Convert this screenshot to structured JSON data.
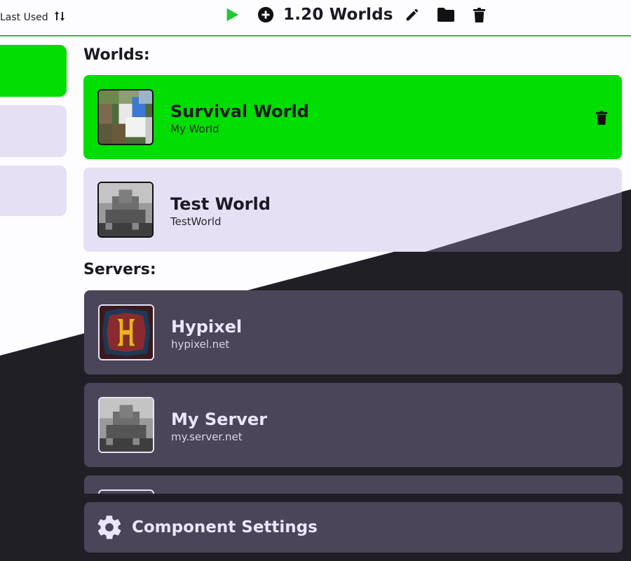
{
  "toolbar": {
    "sort_label": "Last Used",
    "title": "1.20 Worlds",
    "icons": [
      "play-icon",
      "add-icon",
      "edit-icon",
      "folder-icon",
      "trash-icon"
    ],
    "accent": "#22c832"
  },
  "sections": {
    "worlds": "Worlds:",
    "servers": "Servers:"
  },
  "worlds": [
    {
      "name": "Survival World",
      "sub": "My World",
      "selected": true
    },
    {
      "name": "Test World",
      "sub": "TestWorld",
      "selected": false
    }
  ],
  "servers": [
    {
      "name": "Hypixel",
      "sub": "hypixel.net"
    },
    {
      "name": "My Server",
      "sub": "my.server.net"
    }
  ],
  "settings": {
    "label": "Component Settings"
  },
  "colors": {
    "selected": "#00dd00",
    "card_light": "#e6e0f5",
    "card_dark": "#4a4558",
    "background_dark": "#201f26"
  }
}
